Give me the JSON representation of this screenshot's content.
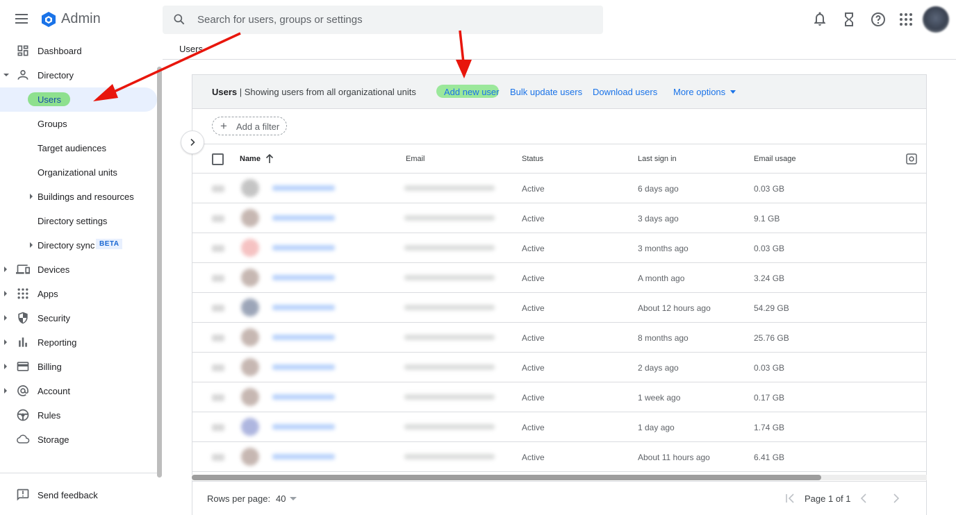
{
  "topbar": {
    "app_title": "Admin",
    "search_placeholder": "Search for users, groups or settings",
    "icons": [
      "menu-icon",
      "admin-logo-icon",
      "search-icon",
      "bell-icon",
      "hourglass-icon",
      "help-icon",
      "apps-grid-icon",
      "avatar"
    ]
  },
  "sidebar": {
    "items": [
      {
        "label": "Dashboard",
        "icon": "dashboard-icon"
      },
      {
        "label": "Directory",
        "icon": "person-icon"
      },
      {
        "label": "Users"
      },
      {
        "label": "Groups"
      },
      {
        "label": "Target audiences"
      },
      {
        "label": "Organizational units"
      },
      {
        "label": "Buildings and resources"
      },
      {
        "label": "Directory settings"
      },
      {
        "label": "Directory sync",
        "badge": "BETA"
      },
      {
        "label": "Devices",
        "icon": "devices-icon"
      },
      {
        "label": "Apps",
        "icon": "apps-icon"
      },
      {
        "label": "Security",
        "icon": "shield-icon"
      },
      {
        "label": "Reporting",
        "icon": "bar-chart-icon"
      },
      {
        "label": "Billing",
        "icon": "credit-card-icon"
      },
      {
        "label": "Account",
        "icon": "at-sign-icon"
      },
      {
        "label": "Rules",
        "icon": "rules-icon"
      },
      {
        "label": "Storage",
        "icon": "cloud-icon"
      }
    ],
    "feedback": "Send feedback"
  },
  "main": {
    "breadcrumb": "Users",
    "header": {
      "title": "Users",
      "subtitle": "| Showing users from all organizational units",
      "add_new_user": "Add new user",
      "bulk_update": "Bulk update users",
      "download": "Download users",
      "more_options": "More options"
    },
    "add_filter": "Add a filter",
    "columns": {
      "name": "Name",
      "email": "Email",
      "status": "Status",
      "last_sign_in": "Last sign in",
      "email_usage": "Email usage"
    },
    "rows": [
      {
        "status": "Active",
        "last_sign_in": "6 days ago",
        "email_usage": "0.03 GB"
      },
      {
        "status": "Active",
        "last_sign_in": "3 days ago",
        "email_usage": "9.1 GB"
      },
      {
        "status": "Active",
        "last_sign_in": "3 months ago",
        "email_usage": "0.03 GB"
      },
      {
        "status": "Active",
        "last_sign_in": "A month ago",
        "email_usage": "3.24 GB"
      },
      {
        "status": "Active",
        "last_sign_in": "About 12 hours ago",
        "email_usage": "54.29 GB"
      },
      {
        "status": "Active",
        "last_sign_in": "8 months ago",
        "email_usage": "25.76 GB"
      },
      {
        "status": "Active",
        "last_sign_in": "2 days ago",
        "email_usage": "0.03 GB"
      },
      {
        "status": "Active",
        "last_sign_in": "1 week ago",
        "email_usage": "0.17 GB"
      },
      {
        "status": "Active",
        "last_sign_in": "1 day ago",
        "email_usage": "1.74 GB"
      },
      {
        "status": "Active",
        "last_sign_in": "About 11 hours ago",
        "email_usage": "6.41 GB"
      }
    ],
    "footer": {
      "rows_per_page_label": "Rows per page:",
      "rows_per_page_value": "40",
      "page_info": "Page 1 of 1"
    }
  },
  "colors": {
    "accent": "#1a73e8",
    "highlight": "#8ee08e",
    "annotation_arrow": "#e8160c"
  }
}
